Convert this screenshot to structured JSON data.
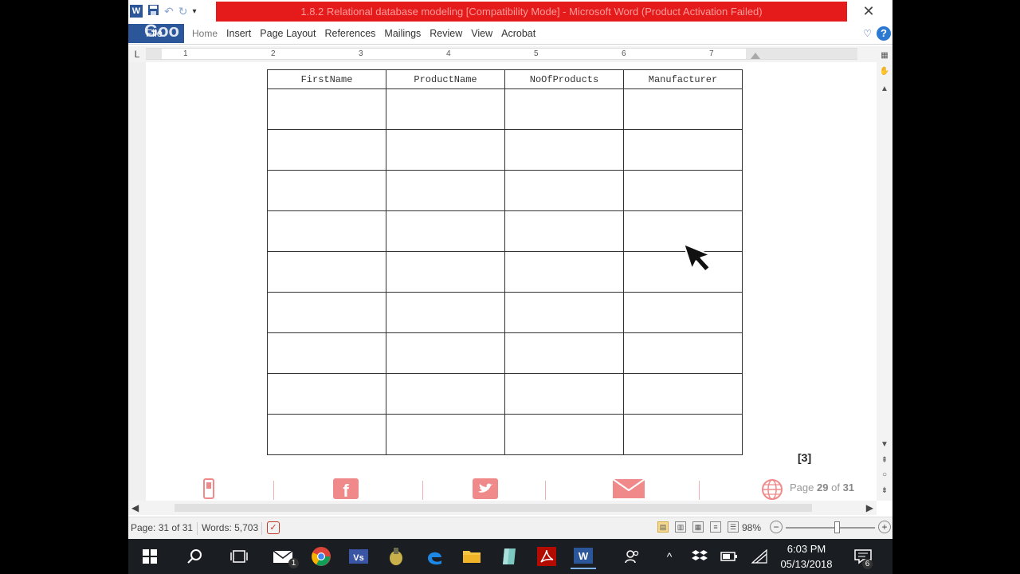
{
  "window": {
    "title": "1.8.2 Relational database modeling [Compatibility Mode] - Microsoft Word (Product Activation Failed)",
    "close_glyph": "✕"
  },
  "quick_access": {
    "icons": [
      "word-logo-icon",
      "save-icon",
      "undo-icon",
      "redo-icon",
      "customize-qat-icon"
    ]
  },
  "ribbon": {
    "file_label": "File",
    "overlay_text": "Goo",
    "tabs": [
      "Home",
      "Insert",
      "Page Layout",
      "References",
      "Mailings",
      "Review",
      "View",
      "Acrobat"
    ]
  },
  "ruler": {
    "corner": "L",
    "numbers": [
      "1",
      "2",
      "3",
      "4",
      "5",
      "6",
      "7"
    ]
  },
  "table": {
    "headers": [
      "FirstName",
      "ProductName",
      "NoOfProducts",
      "Manufacturer"
    ],
    "empty_rows": 9
  },
  "marks_label": "[3]",
  "footer": {
    "icons": [
      "phone-icon",
      "facebook-icon",
      "twitter-icon",
      "mail-icon",
      "globe-icon"
    ],
    "page_prefix": "Page",
    "page_current": "29",
    "page_of": "of",
    "page_total": "31"
  },
  "status": {
    "page": "Page: 31 of 31",
    "words": "Words: 5,703",
    "zoom": "98%",
    "zoom_fraction": 0.58
  },
  "taskbar": {
    "time": "6:03 PM",
    "date": "05/13/2018",
    "mail_badge": "1",
    "notification_badge": "6",
    "apps": [
      "start-icon",
      "search-icon",
      "task-view-icon",
      "mail-icon",
      "chrome-icon",
      "visio-icon",
      "gimp-icon",
      "edge-icon",
      "file-explorer-icon",
      "app-icon",
      "acrobat-icon",
      "word-icon"
    ]
  },
  "colors": {
    "title_bar_accent": "#e51a1a",
    "word_blue": "#2b579a",
    "footer_pink": "#f08a8a"
  }
}
